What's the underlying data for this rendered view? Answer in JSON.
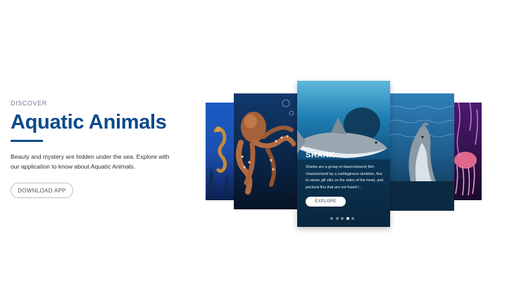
{
  "hero": {
    "eyebrow": "DISCOVER",
    "title": "Aquatic Animals",
    "description": "Beauty and mystery are hidden under the sea. Explore with our application to know about Aquatic Animals.",
    "download_label": "DOWNLOAD APP"
  },
  "carousel": {
    "active_index": 3,
    "slide_count": 5,
    "main_card": {
      "title": "SHARK",
      "text": "Sharks are a group of elasmobranch fish characterized by a cartilaginous skeleton, five to seven gill slits on the sides of the head, and pectoral fins that are not fused t...",
      "explore_label": "EXPLORE"
    },
    "side_cards": [
      "seahorse",
      "octopus",
      "dolphin",
      "jellyfish"
    ]
  },
  "colors": {
    "brand": "#0b4a8a",
    "text": "#2a2f36",
    "muted": "#6b7a8c",
    "button_border": "#b9bec6"
  }
}
